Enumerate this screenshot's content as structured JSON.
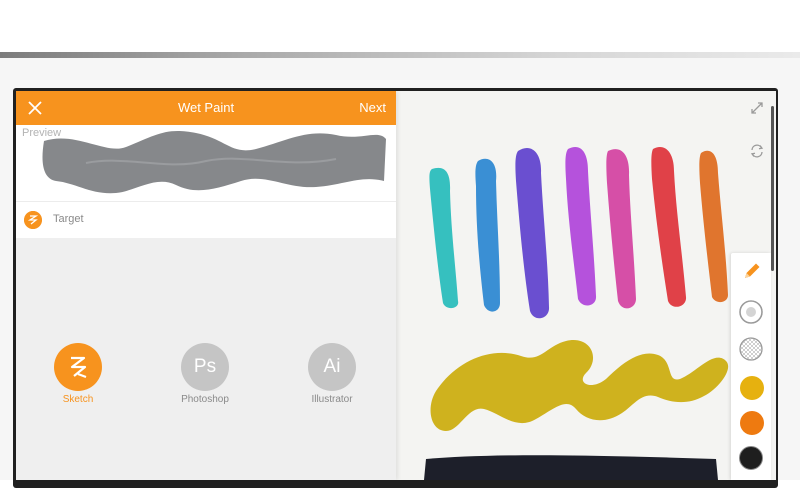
{
  "dialog": {
    "title": "Wet Paint",
    "next_label": "Next",
    "preview_label": "Preview",
    "target_label": "Target"
  },
  "apps": [
    {
      "label": "Sketch",
      "glyph": "",
      "selected": true
    },
    {
      "label": "Photoshop",
      "glyph": "Ps",
      "selected": false
    },
    {
      "label": "Illustrator",
      "glyph": "Ai",
      "selected": false
    }
  ],
  "colors": {
    "accent": "#f7931e",
    "preview_stroke": "#86888b",
    "strokes": [
      "#36c0bf",
      "#3a8fd4",
      "#6a4fd0",
      "#b552dc",
      "#d64fa7",
      "#e04148",
      "#e0752e"
    ],
    "yellow_stroke": "#cfb21e",
    "black_stroke": "#1d1f2a",
    "tool_swatches": [
      "#e6b10f",
      "#ee7a10",
      "#1e1e1e"
    ]
  },
  "icons": [
    "close-icon",
    "expand-icon",
    "sync-icon",
    "pencil-icon",
    "brush-size-icon",
    "opacity-icon",
    "sketch-icon"
  ]
}
